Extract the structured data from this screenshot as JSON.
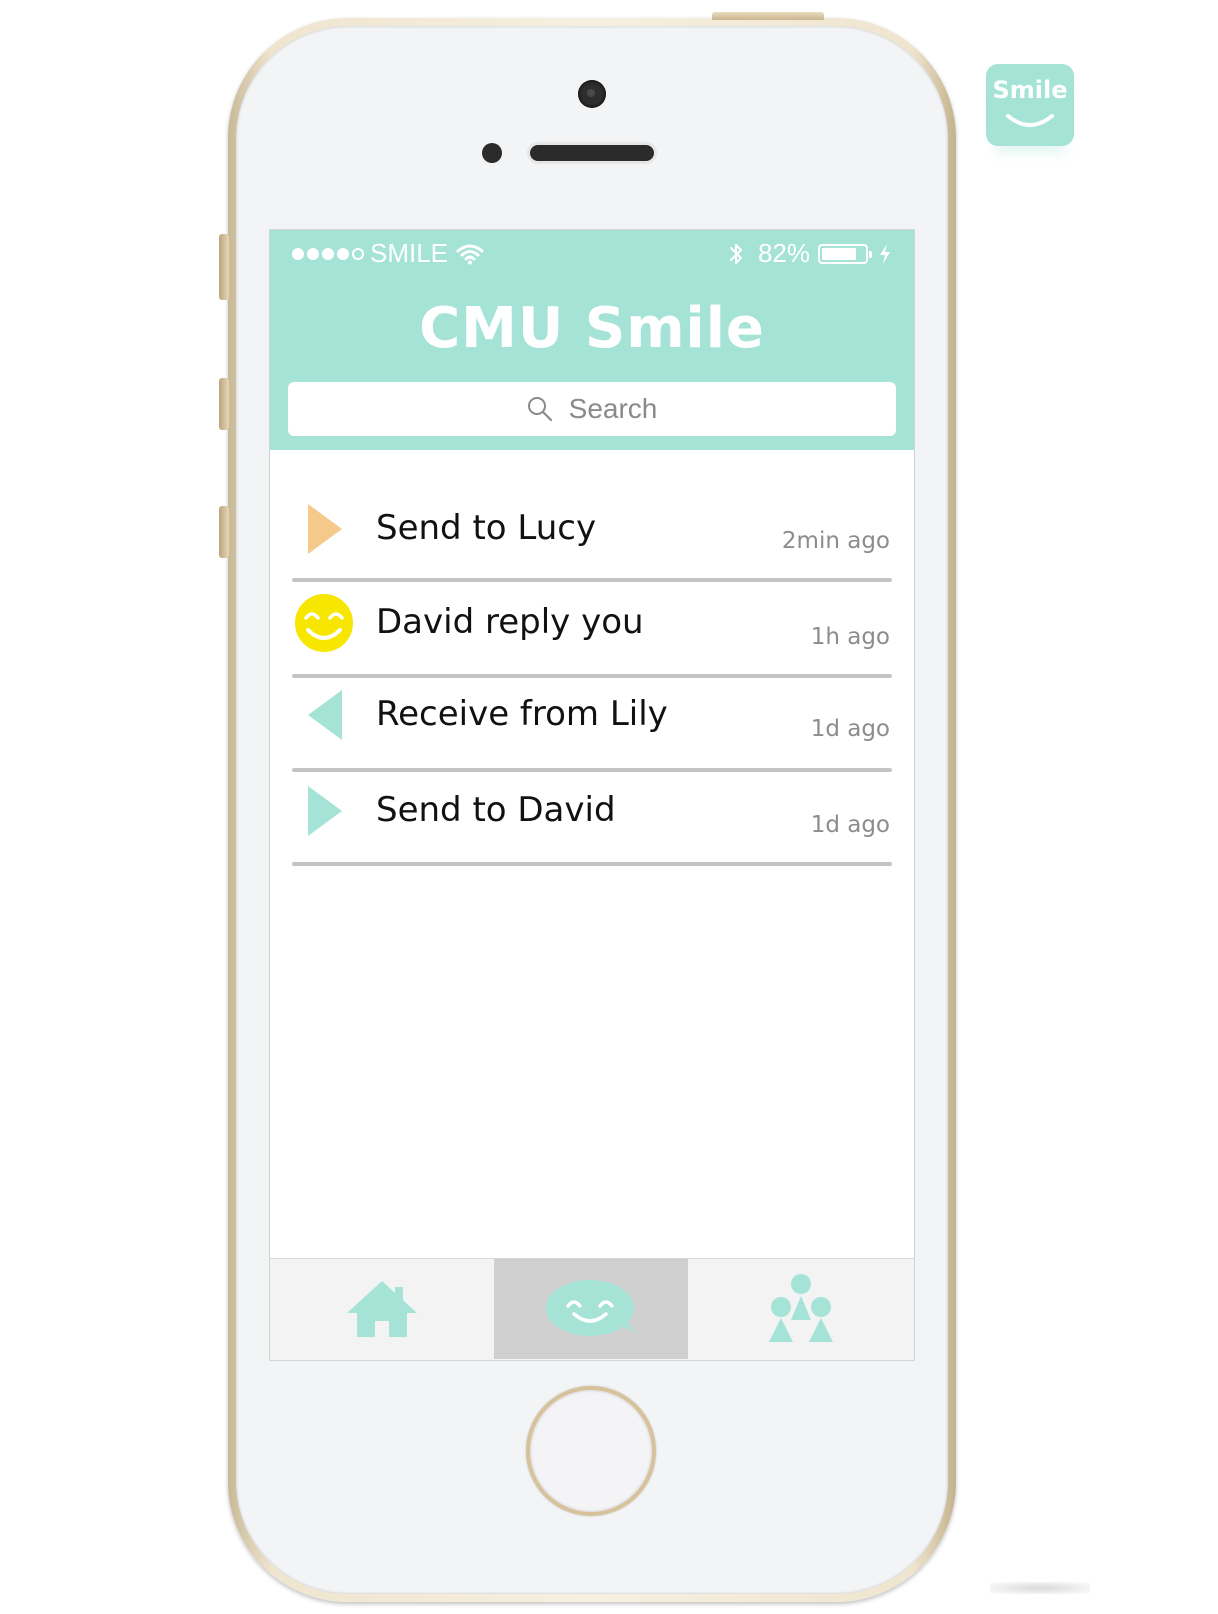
{
  "status_bar": {
    "carrier": "SMILE",
    "battery": "82%",
    "battery_level": 0.82
  },
  "header": {
    "title": "CMU Smile"
  },
  "search": {
    "placeholder": "Search"
  },
  "messages": [
    {
      "label": "Send to Lucy",
      "time": "2min ago",
      "icon": "send-arrow-icon",
      "color": "#f5c98a"
    },
    {
      "label": "David reply you",
      "time": "1h ago",
      "icon": "smiley-face-icon",
      "color": "#f6e600"
    },
    {
      "label": "Receive from Lily",
      "time": "1d ago",
      "icon": "receive-arrow-icon",
      "color": "#a6e3d7"
    },
    {
      "label": "Send to David",
      "time": "1d ago",
      "icon": "send-arrow-icon",
      "color": "#a6e3d7"
    }
  ],
  "tabs": [
    {
      "name": "home-icon",
      "active": false
    },
    {
      "name": "smile-chat-icon",
      "active": true
    },
    {
      "name": "friends-icon",
      "active": false
    }
  ],
  "badge": {
    "text": "Smile"
  },
  "colors": {
    "accent": "#a6e3d7",
    "send_orange": "#f5c98a",
    "smiley_yellow": "#f6e600",
    "active_tab": "#cfcfcf"
  }
}
